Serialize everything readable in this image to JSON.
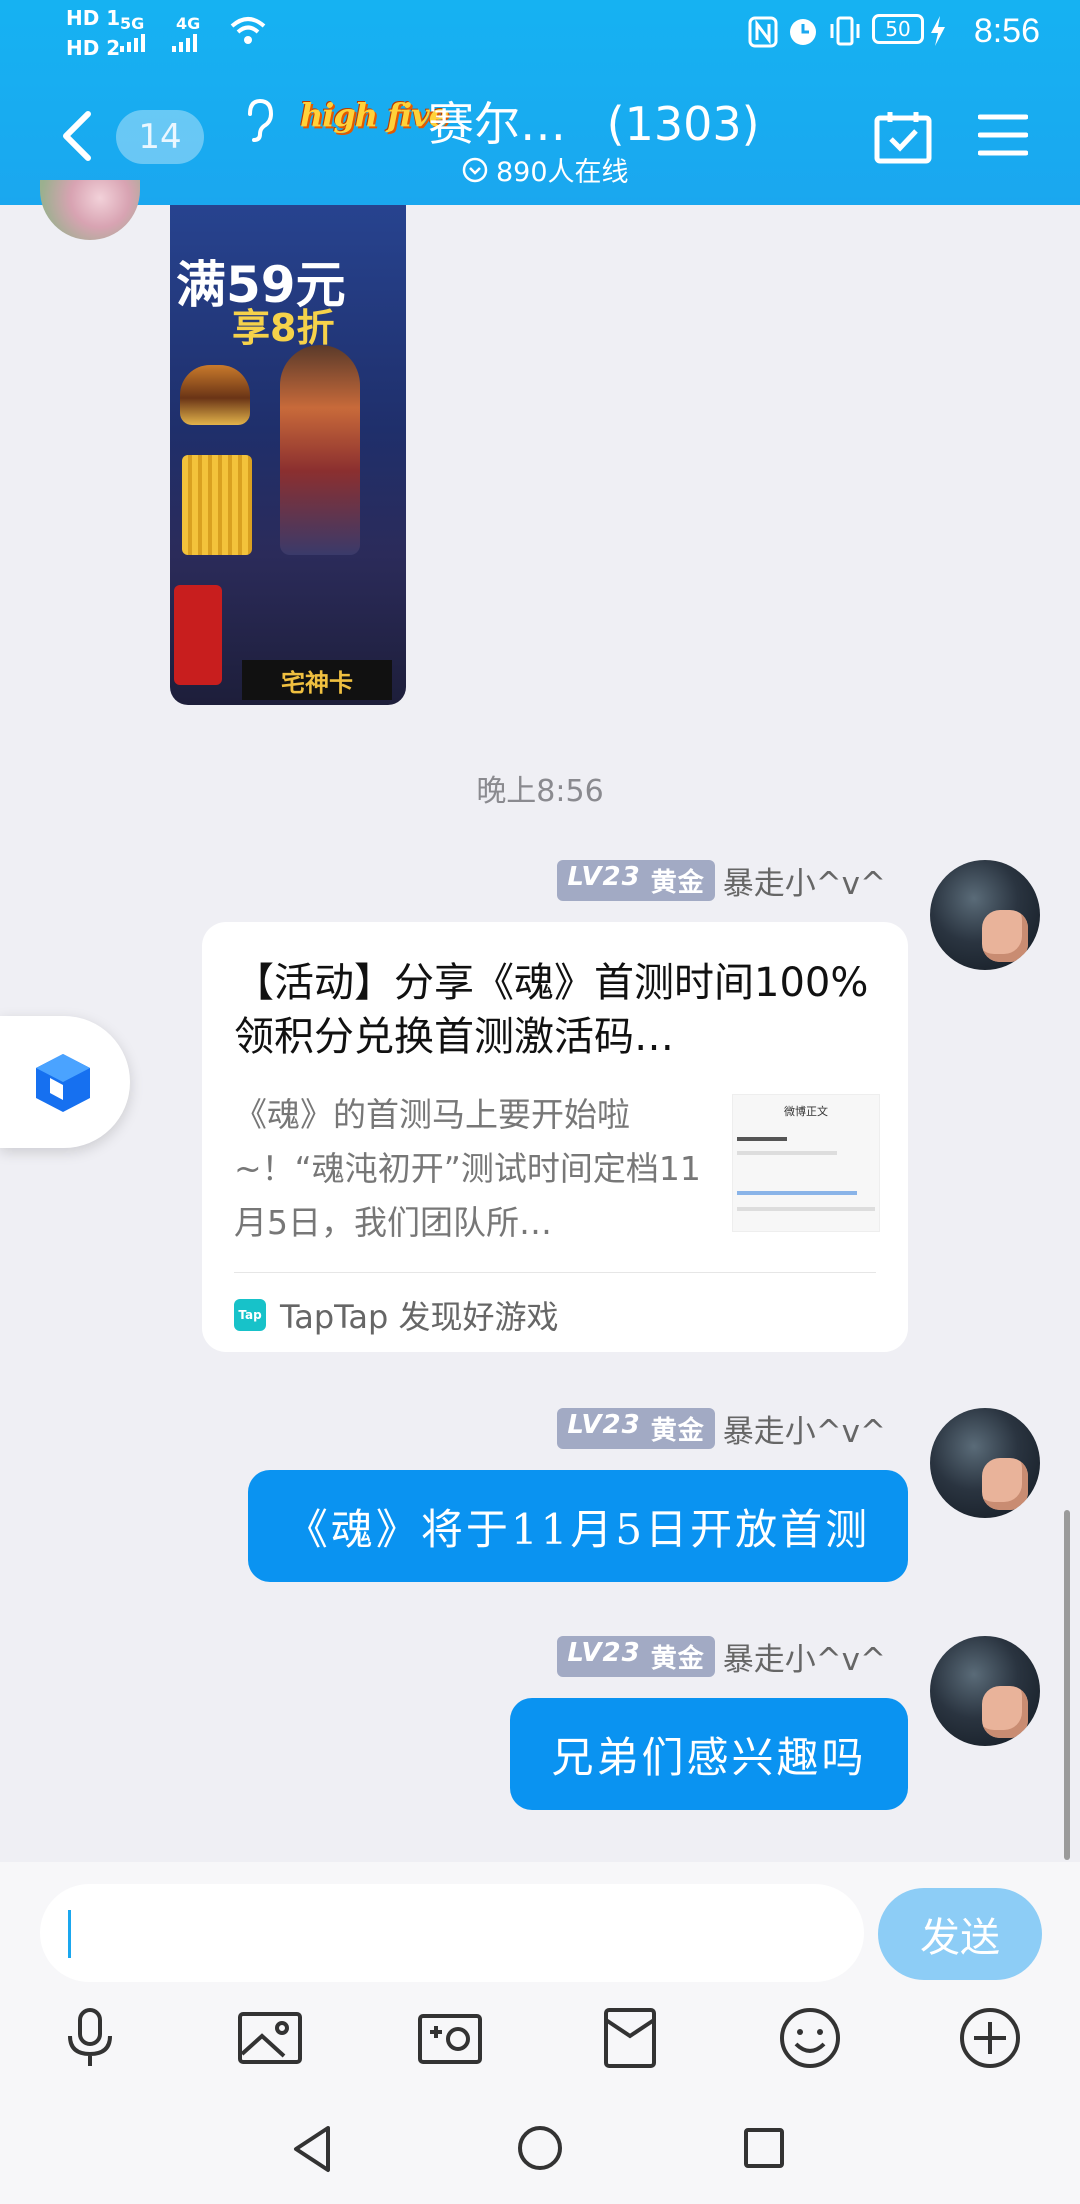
{
  "status_bar": {
    "left_badges": [
      "HD 1",
      "HD 2"
    ],
    "network": [
      "5G",
      "4G"
    ],
    "battery": "50",
    "time": "8:56"
  },
  "header": {
    "unread_count": "14",
    "group_logo_text": "high five",
    "group_name": "赛尔…",
    "member_count": "(1303)",
    "online_text": "890人在线"
  },
  "chat": {
    "timestamp": "晚上8:56",
    "image_text": {
      "line1": "满59元",
      "line2": "享8折",
      "card": "宅神卡"
    },
    "messages": [
      {
        "level": "LV23",
        "rank": "黄金",
        "sender": "暴走小^v^",
        "type": "link-card",
        "title": "【活动】分享《魂》首测时间100%领积分兑换首测激活码…",
        "description": "《魂》的首测马上要开始啦~！“魂沌初开”测试时间定档11月5日，我们团队所…",
        "thumbnail_title": "微博正文",
        "source": "TapTap 发现好游戏",
        "source_logo": "Tap"
      },
      {
        "level": "LV23",
        "rank": "黄金",
        "sender": "暴走小^v^",
        "type": "text",
        "text": "《魂》将于11月5日开放首测"
      },
      {
        "level": "LV23",
        "rank": "黄金",
        "sender": "暴走小^v^",
        "type": "text",
        "text": "兄弟们感兴趣吗"
      }
    ]
  },
  "input": {
    "placeholder": "",
    "send_label": "发送"
  },
  "toolbar": [
    "microphone-icon",
    "image-icon",
    "camera-icon",
    "red-packet-icon",
    "emoji-icon",
    "plus-icon"
  ],
  "colors": {
    "header": "#1aa7ef",
    "bubble": "#0a93f1",
    "send": "#8dcdf6",
    "level_badge": "#a2aac4"
  }
}
